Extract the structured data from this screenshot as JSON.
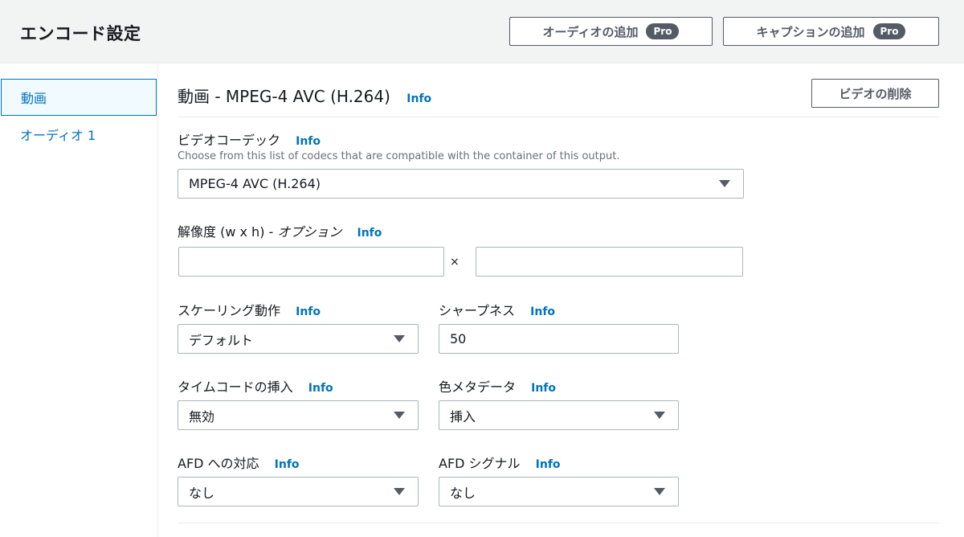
{
  "header": {
    "title": "エンコード設定",
    "add_audio_label": "オーディオの追加",
    "add_caption_label": "キャプションの追加",
    "pro_badge": "Pro"
  },
  "sidebar": {
    "items": [
      {
        "label": "動画",
        "active": true
      },
      {
        "label": "オーディオ 1",
        "active": false
      }
    ]
  },
  "main": {
    "title": "動画 - MPEG-4 AVC (H.264)",
    "info": "Info",
    "delete_video_label": "ビデオの削除",
    "video_codec": {
      "label": "ビデオコーデック",
      "description": "Choose from this list of codecs that are compatible with the container of this output.",
      "value": "MPEG-4 AVC (H.264)"
    },
    "resolution": {
      "label": "解像度 (w x h) - ",
      "label_optional": "オプション",
      "width_value": "",
      "height_value": "",
      "separator": "×"
    },
    "scaling": {
      "label": "スケーリング動作",
      "value": "デフォルト"
    },
    "sharpness": {
      "label": "シャープネス",
      "value": "50"
    },
    "timecode": {
      "label": "タイムコードの挿入",
      "value": "無効"
    },
    "color_metadata": {
      "label": "色メタデータ",
      "value": "挿入"
    },
    "afd_response": {
      "label": "AFD への対応",
      "value": "なし"
    },
    "afd_signal": {
      "label": "AFD シグナル",
      "value": "なし"
    }
  },
  "colors": {
    "accent": "#0073bb",
    "header_bg": "#f2f3f3",
    "button_border": "#545b64",
    "input_border": "#aab7b8"
  }
}
